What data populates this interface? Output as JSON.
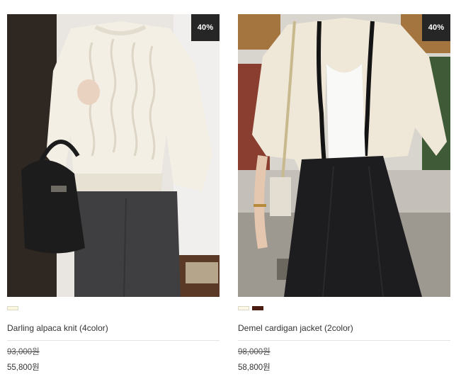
{
  "products": [
    {
      "name": "Darling alpaca knit (4color)",
      "discount_badge": "40%",
      "original_price": "93,000원",
      "sale_price": "55,800원",
      "swatches": [
        "#fbf7de"
      ]
    },
    {
      "name": "Demel cardigan jacket (2color)",
      "discount_badge": "40%",
      "original_price": "98,000원",
      "sale_price": "58,800원",
      "swatches": [
        "#fbf7e6",
        "#4a1c12"
      ]
    }
  ]
}
